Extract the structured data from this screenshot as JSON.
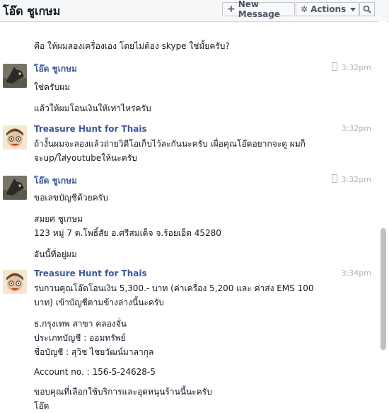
{
  "header": {
    "title": "โอ๊ด ชูเกษม",
    "new_message_label": "New Message",
    "actions_label": "Actions"
  },
  "messages": {
    "pre": {
      "line1": "คือ ให้ผมลองเครื่องเอง โดยไม่ต้อง skype ใช่มั้ยครับ?"
    },
    "m1": {
      "sender": "โอ๊ด ชูเกษม",
      "time": "3:32pm",
      "line1": "ใช่ครับผม",
      "line2": "แล้วให้ผมโอนเงินให้เท่าไหร่ครับ"
    },
    "m2": {
      "sender": "Treasure Hunt for Thais",
      "time": "3:32pm",
      "line1": "ถ้างั้นผมจะลองแล้วถ่ายวิดีโอเก็บไว้ละกันนะครับ เผื่อคุณโอ๊ดอยากจะดู ผมก็",
      "line2": "จะup/ใส่youtubeให้นะครับ"
    },
    "m3": {
      "sender": "โอ๊ด ชูเกษม",
      "time": "3:32pm",
      "line1": "ขอเลขบัญชีด้วยครับ",
      "line2": "สมยศ ชูเกษม",
      "line3": "123 หมู่ 7 ต.โพธิ์สัย อ.ศรีสมเด็จ จ.ร้อยเอ็ด 45280",
      "line4": "อันนี้ที่อยู่ผม"
    },
    "m4": {
      "sender": "Treasure Hunt for Thais",
      "time": "3:34pm",
      "line1": "รบกวนคุณโอ๊ดโอนเงิน 5,300.- บาท (ค่าเครื่อง 5,200 และ ค่าส่ง EMS 100",
      "line2": "บาท) เข้าบัญชีตามข้างล่างนี้นะครับ",
      "line3": "ธ.กรุงเทพ สาขา คลองจั่น",
      "line4": "ประเภทบัญชี : ออมทรัพย์",
      "line5": "ชื่อบัญชี : สุวิช ไชยวัฒน์มาลากุล",
      "line6": "Account no. : 156-5-24628-5",
      "line7": "ขอบคุณที่เลือกใช้บริการและอุดหนุนร้านนี้นะครับ",
      "line8": "โอ๊ด"
    }
  }
}
